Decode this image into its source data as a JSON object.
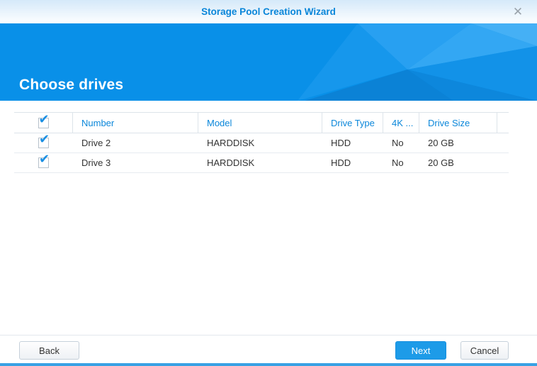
{
  "window": {
    "title": "Storage Pool Creation Wizard",
    "close_glyph": "✕"
  },
  "banner": {
    "heading": "Choose drives"
  },
  "table": {
    "check_glyph": "✔",
    "select_all_checked": true,
    "columns": {
      "number": "Number",
      "model": "Model",
      "drive_type": "Drive Type",
      "four_k": "4K ...",
      "drive_size": "Drive Size"
    },
    "rows": [
      {
        "checked": true,
        "number": "Drive 2",
        "model": "HARDDISK",
        "drive_type": "HDD",
        "four_k": "No",
        "drive_size": "20 GB"
      },
      {
        "checked": true,
        "number": "Drive 3",
        "model": "HARDDISK",
        "drive_type": "HDD",
        "four_k": "No",
        "drive_size": "20 GB"
      }
    ]
  },
  "footer": {
    "back": "Back",
    "next": "Next",
    "cancel": "Cancel"
  },
  "colors": {
    "accent_blue": "#0990e8",
    "title_blue": "#0a86d9",
    "header_text_blue": "#0b87da",
    "check_blue": "#1a8fe3",
    "primary_button": "#1d9be8",
    "row_text": "#333333",
    "border_light": "#dde4ea",
    "bottom_strip": "#38a1e4"
  }
}
